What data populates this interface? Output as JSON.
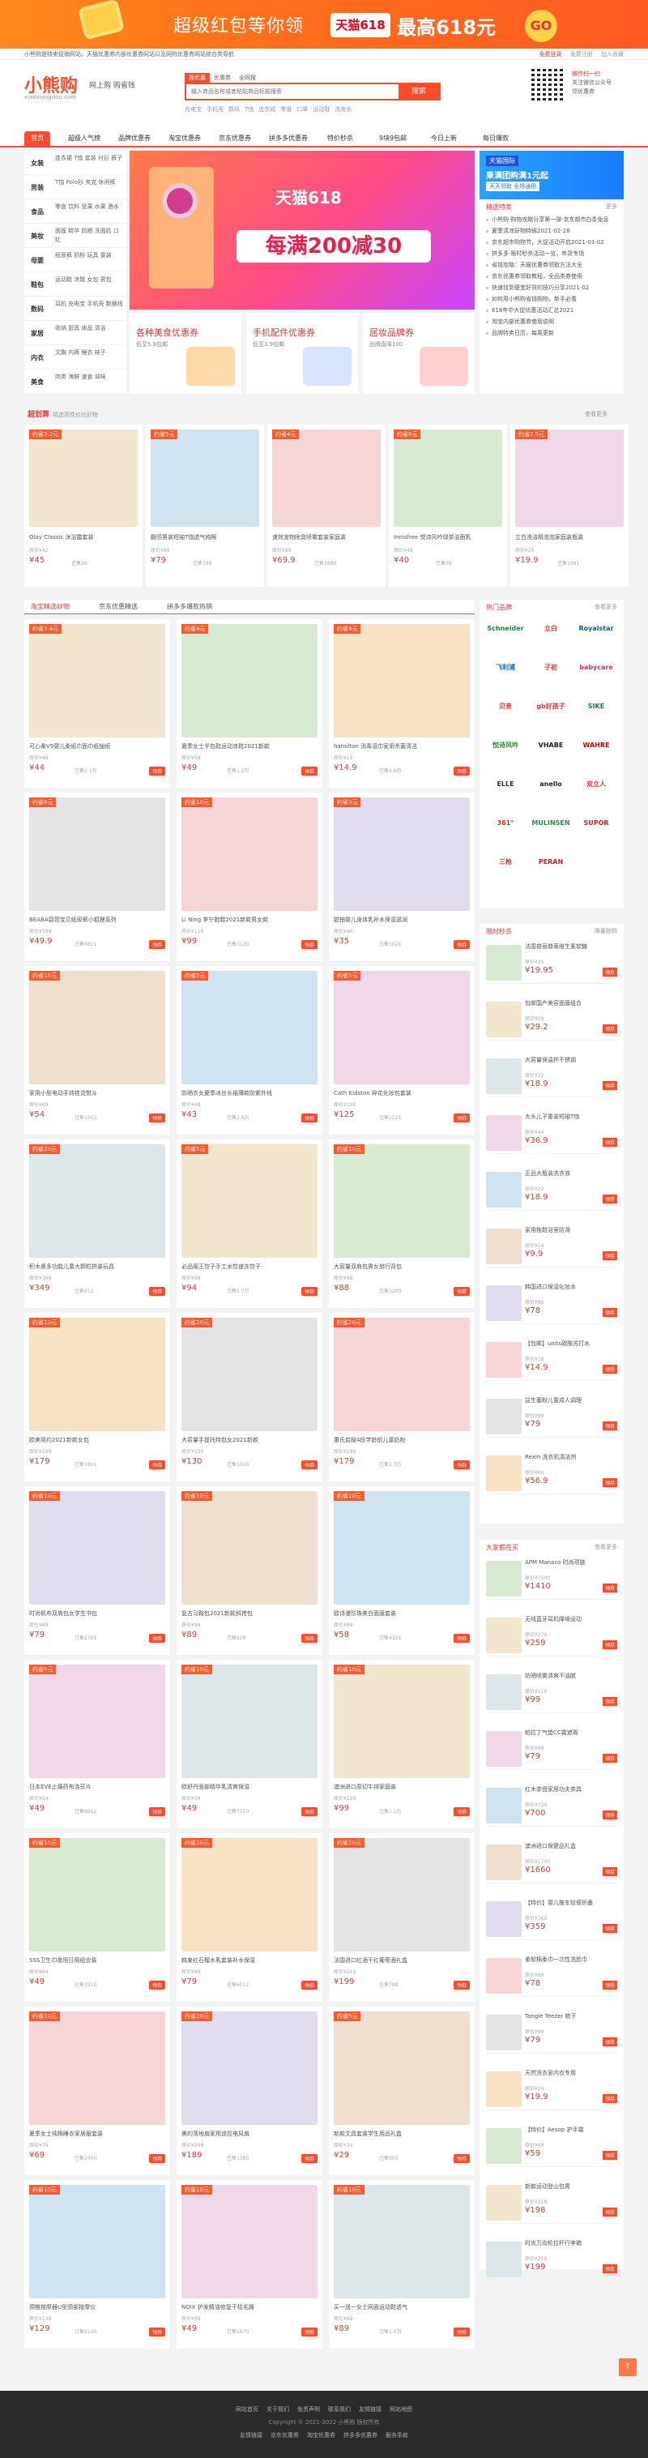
{
  "banner": {
    "main": "超级红包等你领",
    "tmall": "天猫618",
    "big": "最高618元",
    "go": "GO"
  },
  "topbar": {
    "left": "小熊购是特卖促销网站，天猫优惠券内部优惠券网站以及网购优惠券网站综合类导航",
    "login": "免费登录",
    "register": "免费注册",
    "fav": "加入收藏"
  },
  "header": {
    "logo": "小熊购",
    "domain": "xiaoxiongdou.com",
    "slogan": "网上购  购省钱",
    "search_tabs": [
      "搜优惠",
      "优惠券",
      "全网搜"
    ],
    "search_placeholder": "输入商品名称或者粘贴商品标题搜索",
    "search_button": "搜索",
    "hotwords": [
      "充电宝",
      "手机壳",
      "数码",
      "T恤",
      "连衣裙",
      "零食",
      "口罩",
      "运动鞋",
      "洗发水"
    ],
    "follow_title": "微信扫一扫",
    "follow_sub": "关注微信公众号",
    "follow_sub2": "领优惠券"
  },
  "nav": [
    "首页",
    "超级人气榜",
    "品牌优惠券",
    "淘宝优惠券",
    "京东优惠券",
    "拼多多优惠券",
    "特价秒杀",
    "9块9包邮",
    "今日上新",
    "每日爆款"
  ],
  "categories": [
    {
      "t": "女装",
      "s": "连衣裙 T恤 套装 衬衫 裤子"
    },
    {
      "t": "男装",
      "s": "T恤 Polo衫 夹克 休闲裤"
    },
    {
      "t": "食品",
      "s": "零食 饮料 坚果 水果 酒水"
    },
    {
      "t": "美妆",
      "s": "面膜 精华 防晒 洗面奶 口红"
    },
    {
      "t": "母婴",
      "s": "纸尿裤 奶粉 玩具 童装"
    },
    {
      "t": "鞋包",
      "s": "运动鞋 凉鞋 女包 男包"
    },
    {
      "t": "数码",
      "s": "耳机 充电宝 手机壳 数据线"
    },
    {
      "t": "家居",
      "s": "收纳 厨具 床品 清洁"
    },
    {
      "t": "内衣",
      "s": "文胸 内裤 睡衣 袜子"
    },
    {
      "t": "美食",
      "s": "肉类 海鲜 速食 调味"
    }
  ],
  "hero": {
    "brand": "天猫618",
    "title": "每满200减30"
  },
  "promos": [
    {
      "t": "各种美食优惠券",
      "s": "低至5.9包邮"
    },
    {
      "t": "手机配件优惠券",
      "s": "低至3.9包邮"
    },
    {
      "t": "居妆品牌券",
      "s": "品牌直降100"
    }
  ],
  "rside": {
    "logo": "天猫国际",
    "banner": "果满团购满1元起",
    "badge": "天天领取 全场通用",
    "news_title": "精选特卖",
    "news_more": "更多",
    "news": [
      "小熊购·购物攻略分享第一弹·京东超市白条免息",
      "夏季清凉好物特辑2021-02-28",
      "京东超市购物节，大促活动开启2021-03-02",
      "拼多多·限时秒杀活动一览，年货专场",
      "省钱攻略：天猫优惠券领取方法大全",
      "京东优惠券领取教程，全品类券使用",
      "快速找到便宜好货的技巧分享2021-02",
      "如何用小熊购省钱购物，新手必看",
      "618年中大促优惠活动汇总2021",
      "淘宝内部优惠券使用说明",
      "品牌特卖日历，每周更新"
    ]
  },
  "super": {
    "title": "超划算",
    "sub": "精选高性价比好物",
    "more": "查看更多",
    "items": [
      {
        "tag": "约省3.2元",
        "title": "Olay Classic 沐浴露套装",
        "meta": "原价¥42",
        "price": "¥45",
        "sold": "已售26"
      },
      {
        "tag": "约省5元",
        "title": "翻领男装短袖T恤透气纯棉",
        "meta": "原价¥89",
        "price": "¥79",
        "sold": "已售186"
      },
      {
        "tag": "约省4元",
        "title": "速效宠物除臭喷雾套装家庭装",
        "meta": "原价¥80",
        "price": "¥69.9",
        "sold": "已售2680"
      },
      {
        "tag": "约省8元",
        "title": "Innisfree 悦诗风吟绿茶洁面乳",
        "meta": "原价¥48",
        "price": "¥40",
        "sold": "已售59"
      },
      {
        "tag": "约省2.5元",
        "title": "立白洗洁精泡泡家庭装瓶装",
        "meta": "原价¥29",
        "price": "¥19.9",
        "sold": "已售1891"
      }
    ]
  },
  "tabs": [
    "淘宝精选好物",
    "京东优惠精选",
    "拼多多爆款热销"
  ],
  "grid": [
    {
      "tag": "约省3.4元",
      "title": "可心柔V9婴儿柔纸巾面巾纸抽纸",
      "meta": "原价¥48",
      "price": "¥44",
      "sold": "已售2.1万"
    },
    {
      "tag": "约省4元",
      "title": "夏季女士半包鞋运动凉鞋2021新款",
      "meta": "原价¥58",
      "price": "¥49",
      "sold": "已售1.2万"
    },
    {
      "tag": "约省4元",
      "title": "hamilton 消毒湿巾家用杀菌清洁",
      "meta": "原价¥19",
      "price": "¥14.9",
      "sold": "已售4.6万"
    },
    {
      "tag": "约省8元",
      "title": "BEABA碧芭宝贝纸尿裤小狐狸系列",
      "meta": "原价¥189",
      "price": "¥49.9",
      "sold": "已售6811"
    },
    {
      "tag": "约省10元",
      "title": "Li Ning 李宁跑鞋2021新款男女款",
      "meta": "原价¥119",
      "price": "¥99",
      "sold": "已售3120"
    },
    {
      "tag": "约省3元",
      "title": "甜柚婴儿身体乳补水保湿滋润",
      "meta": "原价¥40",
      "price": "¥35",
      "sold": "已售5021"
    },
    {
      "tag": "约省15元",
      "title": "家用小型电动手持挂烫熨斗",
      "meta": "原价¥69",
      "price": "¥54",
      "sold": "已售1903"
    },
    {
      "tag": "约省5元",
      "title": "防晒衣女夏季冰丝长袖薄款防紫外线",
      "meta": "原价¥48",
      "price": "¥43",
      "sold": "已售2.8万"
    },
    {
      "tag": "约省5元",
      "title": "Cath Kidston 碎花化妆包套装",
      "meta": "原价¥130",
      "price": "¥125",
      "sold": "已售1221"
    },
    {
      "tag": "约省20元",
      "title": "积木桌多功能儿童大颗粒拼装玩具",
      "meta": "原价¥369",
      "price": "¥349",
      "sold": "已售612"
    },
    {
      "tag": "约省5元",
      "title": "必品阁王饺子手工水饺速冻饺子",
      "meta": "原价¥99",
      "price": "¥94",
      "sold": "已售1.7万"
    },
    {
      "tag": "约省10元",
      "title": "大容量双肩包男女旅行背包",
      "meta": "原价¥98",
      "price": "¥88",
      "sold": "已售3200"
    },
    {
      "tag": "约省10元",
      "title": "欧美简约2021新款女包",
      "meta": "原价¥189",
      "price": "¥179",
      "sold": "已售1801"
    },
    {
      "tag": "约省20元",
      "title": "大容量手提托特包女2021新款",
      "meta": "原价¥150",
      "price": "¥130",
      "sold": "已售1010"
    },
    {
      "tag": "约省20元",
      "title": "惠氏启赋4段学龄前儿童奶粉",
      "meta": "原价¥199",
      "price": "¥179",
      "sold": "已售2.3万"
    },
    {
      "tag": "约省10元",
      "title": "时尚帆布双肩包女学生书包",
      "meta": "原价¥89",
      "price": "¥79",
      "sold": "已售2701"
    },
    {
      "tag": "约省10元",
      "title": "复古马鞍包2021新款斜挎包",
      "meta": "原价¥99",
      "price": "¥89",
      "sold": "已售826"
    },
    {
      "tag": "约省10元",
      "title": "欧诗漫珍珠美白面膜套装",
      "meta": "原价¥68",
      "price": "¥58",
      "sold": "已售4321"
    },
    {
      "tag": "约省5元",
      "title": "日本EVE止痛药布洛芬片",
      "meta": "原价¥54",
      "price": "¥49",
      "sold": "已售9862"
    },
    {
      "tag": "约省10元",
      "title": "欧舒丹面部精华乳清爽保湿",
      "meta": "原价¥59",
      "price": "¥49",
      "sold": "已售7210"
    },
    {
      "tag": "约省10元",
      "title": "澳洲进口原切牛排家庭装",
      "meta": "原价¥109",
      "price": "¥99",
      "sold": "已售1.1万"
    },
    {
      "tag": "约省15元",
      "title": "SSS卫生巾夜用日用组合装",
      "meta": "原价¥64",
      "price": "¥49",
      "sold": "已售3510"
    },
    {
      "tag": "约省10元",
      "title": "韩束红石榴水乳套装补水保湿",
      "meta": "原价¥89",
      "price": "¥79",
      "sold": "已售6012"
    },
    {
      "tag": "约省20元",
      "title": "法国进口红酒干红葡萄酒礼盒",
      "meta": "原价¥219",
      "price": "¥199",
      "sold": "已售788"
    },
    {
      "tag": "约省10元",
      "title": "夏季女士纯棉睡衣家居服套装",
      "meta": "原价¥79",
      "price": "¥69",
      "sold": "已售2450"
    },
    {
      "tag": "约省20元",
      "title": "美的落地扇家用遥控电风扇",
      "meta": "原价¥209",
      "price": "¥189",
      "sold": "已售1380"
    },
    {
      "tag": "约省5元",
      "title": "新款文具套装学生用品礼盒",
      "meta": "原价¥34",
      "price": "¥29",
      "sold": "已售903"
    },
    {
      "tag": "约省10元",
      "title": "颈椎按摩器U型颈部按摩仪",
      "meta": "原价¥139",
      "price": "¥129",
      "sold": "已售2140"
    },
    {
      "tag": "约省10元",
      "title": "NOIX 护发精油修复干枯毛躁",
      "meta": "原价¥59",
      "price": "¥49",
      "sold": "已售1670"
    },
    {
      "tag": "约省10元",
      "title": "买一送一女士网面运动鞋透气",
      "meta": "原价¥99",
      "price": "¥89",
      "sold": "已售1.5万"
    }
  ],
  "brands": {
    "title": "热门品牌",
    "more": "查看更多",
    "list": [
      "Schneider",
      "立白",
      "Royalstar",
      "飞利浦",
      "子初",
      "babycare",
      "贝亲",
      "gb好孩子",
      "SIKE",
      "悦诗风吟",
      "VHABE",
      "WAHRE",
      "ELLE",
      "anello",
      "双立人",
      "361°",
      "MULINSEN",
      "SUPOR",
      "三枪",
      "PERAN"
    ]
  },
  "deals": {
    "title": "限时秒杀",
    "more": "限量抢购",
    "items": [
      {
        "t": "法国普丽普莱维生素软糖",
        "m": "原价¥25",
        "p": "¥19.95"
      },
      {
        "t": "包邮国产美容面膜组合",
        "m": "原价¥29",
        "p": "¥29.2"
      },
      {
        "t": "大容量保温杯不锈钢",
        "m": "原价¥22",
        "p": "¥18.9"
      },
      {
        "t": "大头儿子童装短袖T恤",
        "m": "原价¥44",
        "p": "¥36.9"
      },
      {
        "t": "正品大瓶装洗衣液",
        "m": "原价¥22",
        "p": "¥18.9"
      },
      {
        "t": "家用拖鞋浴室防滑",
        "m": "原价¥14",
        "p": "¥9.9"
      },
      {
        "t": "韩国进口保湿化妆水",
        "m": "原价¥88",
        "p": "¥78"
      },
      {
        "t": "【包邮】units碳酸苏打水",
        "m": "原价¥16",
        "p": "¥14.9"
      },
      {
        "t": "益生菌粉儿童成人调理",
        "m": "原价¥89",
        "p": "¥79"
      },
      {
        "t": "Rexin 洗衣机清洁剂",
        "m": "原价¥64",
        "p": "¥56.9"
      }
    ]
  },
  "ranking": {
    "title": "大家都在买",
    "more": "查看更多",
    "items": [
      {
        "t": "APM Monaco 时尚项链",
        "m": "原价¥1500",
        "p": "¥1410"
      },
      {
        "t": "无线蓝牙耳机降噪运动",
        "m": "原价¥279",
        "p": "¥259"
      },
      {
        "t": "防晒喷雾清爽不油腻",
        "m": "原价¥110",
        "p": "¥99"
      },
      {
        "t": "帕拉丁气垫CC霜遮瑕",
        "m": "原价¥89",
        "p": "¥79"
      },
      {
        "t": "红木茶盘家用功夫茶具",
        "m": "原价¥720",
        "p": "¥700"
      },
      {
        "t": "澳洲进口保健品礼盒",
        "m": "原价¥1700",
        "p": "¥1660"
      },
      {
        "t": "【特价】婴儿推车轻便折叠",
        "m": "原价¥369",
        "p": "¥359"
      },
      {
        "t": "柔软棉柔巾一次性洗脸巾",
        "m": "原价¥88",
        "p": "¥78"
      },
      {
        "t": "Tangle Teezer 梳子",
        "m": "原价¥89",
        "p": "¥79"
      },
      {
        "t": "天然洗衣皂内衣专用",
        "m": "原价¥24",
        "p": "¥19.9"
      },
      {
        "t": "【特价】Aesop 护手霜",
        "m": "原价¥69",
        "p": "¥59"
      },
      {
        "t": "新款运动登山包男",
        "m": "原价¥218",
        "p": "¥198"
      },
      {
        "t": "时尚万向轮拉杆行李箱",
        "m": "原价¥219",
        "p": "¥199"
      }
    ]
  },
  "footer": {
    "links": [
      "网站首页",
      "关于我们",
      "免责声明",
      "联系我们",
      "友情链接",
      "网站地图"
    ],
    "copyright": "Copyright © 2021-2022 小熊购 版权所有",
    "bottom": [
      "友情链接",
      "京东优惠券",
      "淘宝优惠券",
      "拼多多优惠券",
      "服务条款"
    ],
    "totop": "↑"
  }
}
